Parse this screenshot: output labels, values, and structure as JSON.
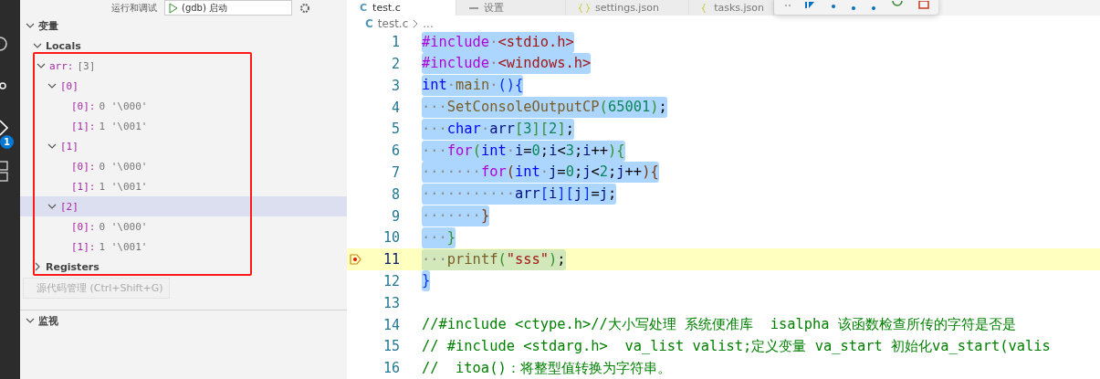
{
  "sidebar": {
    "title": "运行和调试",
    "launch_config": "(gdb) 启动",
    "variables": {
      "title": "变量",
      "expanded": true,
      "scopes": [
        {
          "name": "Locals",
          "expanded": true,
          "children": [
            {
              "name": "arr:",
              "value": "[3]",
              "expanded": true,
              "selected": false,
              "children": [
                {
                  "name": "[0]",
                  "expanded": true,
                  "selected": false,
                  "children": [
                    {
                      "name": "[0]:",
                      "value": "0 '\\000'",
                      "selected": false
                    },
                    {
                      "name": "[1]:",
                      "value": "1 '\\001'",
                      "selected": false
                    }
                  ]
                },
                {
                  "name": "[1]",
                  "expanded": true,
                  "selected": false,
                  "children": [
                    {
                      "name": "[0]:",
                      "value": "0 '\\000'",
                      "selected": false
                    },
                    {
                      "name": "[1]:",
                      "value": "1 '\\001'",
                      "selected": false
                    }
                  ]
                },
                {
                  "name": "[2]",
                  "expanded": true,
                  "selected": true,
                  "children": [
                    {
                      "name": "[0]:",
                      "value": "0 '\\000'",
                      "selected": false
                    },
                    {
                      "name": "[1]:",
                      "value": "1 '\\001'",
                      "selected": false
                    }
                  ]
                }
              ]
            }
          ]
        },
        {
          "name": "Registers",
          "expanded": false
        }
      ]
    },
    "watch": {
      "title": "监视",
      "expanded": true
    }
  },
  "activity_bar": {
    "debug_badge": "1"
  },
  "tooltip": "源代码管理 (Ctrl+Shift+G)",
  "tabs": [
    {
      "label": "test.c",
      "kind": "c",
      "icon": "C",
      "selected": true
    },
    {
      "label": "设置",
      "kind": "settings",
      "selected": false
    },
    {
      "label": "settings.json",
      "kind": "json",
      "selected": false
    },
    {
      "label": "tasks.json",
      "kind": "json",
      "selected": false
    }
  ],
  "breadcrumb": {
    "icon": "C",
    "file": "test.c",
    "rest": "..."
  },
  "code": [
    {
      "n": "1",
      "selected": true,
      "current": false,
      "tokens": [
        {
          "text": "#include",
          "kind": "pre"
        },
        {
          "text": "·",
          "kind": "ws"
        },
        {
          "text": "<stdio.h>",
          "kind": "str"
        }
      ]
    },
    {
      "n": "2",
      "selected": true,
      "current": false,
      "tokens": [
        {
          "text": "#include",
          "kind": "pre"
        },
        {
          "text": "·",
          "kind": "ws"
        },
        {
          "text": "<windows.h>",
          "kind": "str"
        }
      ]
    },
    {
      "n": "3",
      "selected": true,
      "current": false,
      "tokens": [
        {
          "text": "int",
          "kind": "kw"
        },
        {
          "text": "·",
          "kind": "ws"
        },
        {
          "text": "main",
          "kind": "fn"
        },
        {
          "text": "·",
          "kind": "ws"
        },
        {
          "text": "(){",
          "kind": "b1"
        }
      ]
    },
    {
      "n": "4",
      "selected": true,
      "current": false,
      "tokens": [
        {
          "text": "···",
          "kind": "ws"
        },
        {
          "text": "SetConsoleOutputCP",
          "kind": "fn"
        },
        {
          "text": "(",
          "kind": "b2"
        },
        {
          "text": "65001",
          "kind": "num"
        },
        {
          "text": ")",
          "kind": "b2"
        },
        {
          "text": ";",
          "kind": "p"
        }
      ]
    },
    {
      "n": "5",
      "selected": true,
      "current": false,
      "tokens": [
        {
          "text": "···",
          "kind": "ws"
        },
        {
          "text": "char",
          "kind": "kw"
        },
        {
          "text": "·",
          "kind": "ws"
        },
        {
          "text": "arr",
          "kind": "var"
        },
        {
          "text": "[",
          "kind": "b2"
        },
        {
          "text": "3",
          "kind": "num"
        },
        {
          "text": "][",
          "kind": "b2"
        },
        {
          "text": "2",
          "kind": "num"
        },
        {
          "text": "]",
          "kind": "b2"
        },
        {
          "text": ";",
          "kind": "p"
        }
      ]
    },
    {
      "n": "6",
      "selected": true,
      "current": false,
      "tokens": [
        {
          "text": "···",
          "kind": "ws"
        },
        {
          "text": "for",
          "kind": "pre"
        },
        {
          "text": "(",
          "kind": "b2"
        },
        {
          "text": "int",
          "kind": "kw"
        },
        {
          "text": "·",
          "kind": "ws"
        },
        {
          "text": "i",
          "kind": "var"
        },
        {
          "text": "=",
          "kind": "p"
        },
        {
          "text": "0",
          "kind": "num"
        },
        {
          "text": ";",
          "kind": "p"
        },
        {
          "text": "i",
          "kind": "var"
        },
        {
          "text": "<",
          "kind": "p"
        },
        {
          "text": "3",
          "kind": "num"
        },
        {
          "text": ";",
          "kind": "p"
        },
        {
          "text": "i",
          "kind": "var"
        },
        {
          "text": "++",
          "kind": "p"
        },
        {
          "text": "){",
          "kind": "b2"
        }
      ]
    },
    {
      "n": "7",
      "selected": true,
      "current": false,
      "tokens": [
        {
          "text": "·······",
          "kind": "ws"
        },
        {
          "text": "for",
          "kind": "pre"
        },
        {
          "text": "(",
          "kind": "b3"
        },
        {
          "text": "int",
          "kind": "kw"
        },
        {
          "text": "·",
          "kind": "ws"
        },
        {
          "text": "j",
          "kind": "var"
        },
        {
          "text": "=",
          "kind": "p"
        },
        {
          "text": "0",
          "kind": "num"
        },
        {
          "text": ";",
          "kind": "p"
        },
        {
          "text": "j",
          "kind": "var"
        },
        {
          "text": "<",
          "kind": "p"
        },
        {
          "text": "2",
          "kind": "num"
        },
        {
          "text": ";",
          "kind": "p"
        },
        {
          "text": "j",
          "kind": "var"
        },
        {
          "text": "++",
          "kind": "p"
        },
        {
          "text": "){",
          "kind": "b3"
        }
      ]
    },
    {
      "n": "8",
      "selected": true,
      "current": false,
      "tokens": [
        {
          "text": "···········",
          "kind": "ws"
        },
        {
          "text": "arr",
          "kind": "var"
        },
        {
          "text": "[",
          "kind": "b1"
        },
        {
          "text": "i",
          "kind": "var"
        },
        {
          "text": "][",
          "kind": "b1"
        },
        {
          "text": "j",
          "kind": "var"
        },
        {
          "text": "]",
          "kind": "b1"
        },
        {
          "text": "=",
          "kind": "p"
        },
        {
          "text": "j",
          "kind": "var"
        },
        {
          "text": ";",
          "kind": "p"
        }
      ]
    },
    {
      "n": "9",
      "selected": true,
      "current": false,
      "tokens": [
        {
          "text": "·······",
          "kind": "ws"
        },
        {
          "text": "}",
          "kind": "b3"
        }
      ]
    },
    {
      "n": "10",
      "selected": true,
      "current": false,
      "tokens": [
        {
          "text": "···",
          "kind": "ws"
        },
        {
          "text": "}",
          "kind": "b2"
        }
      ]
    },
    {
      "n": "11",
      "selected": true,
      "current": true,
      "tokens": [
        {
          "text": "···",
          "kind": "ws"
        },
        {
          "text": "printf",
          "kind": "fn"
        },
        {
          "text": "(",
          "kind": "b2"
        },
        {
          "text": "\"sss\"",
          "kind": "str"
        },
        {
          "text": ")",
          "kind": "b2"
        },
        {
          "text": ";",
          "kind": "p"
        }
      ]
    },
    {
      "n": "12",
      "selected": true,
      "current": false,
      "tokens": [
        {
          "text": "}",
          "kind": "b1"
        }
      ]
    },
    {
      "n": "13",
      "selected": false,
      "current": false
    },
    {
      "n": "14",
      "selected": false,
      "current": false,
      "tokens": [
        {
          "text": "//#include <ctype.h>//大小写处理 系统便准库  isalpha 该函数检查所传的字符是否是",
          "kind": "com"
        }
      ]
    },
    {
      "n": "15",
      "selected": false,
      "current": false,
      "tokens": [
        {
          "text": "// #include <stdarg.h>  va_list valist;定义变量 va_start 初始化va_start(valis",
          "kind": "com"
        }
      ]
    },
    {
      "n": "16",
      "selected": false,
      "current": false,
      "tokens": [
        {
          "text": "//  itoa()：将整型值转换为字符串。",
          "kind": "com"
        }
      ]
    }
  ]
}
